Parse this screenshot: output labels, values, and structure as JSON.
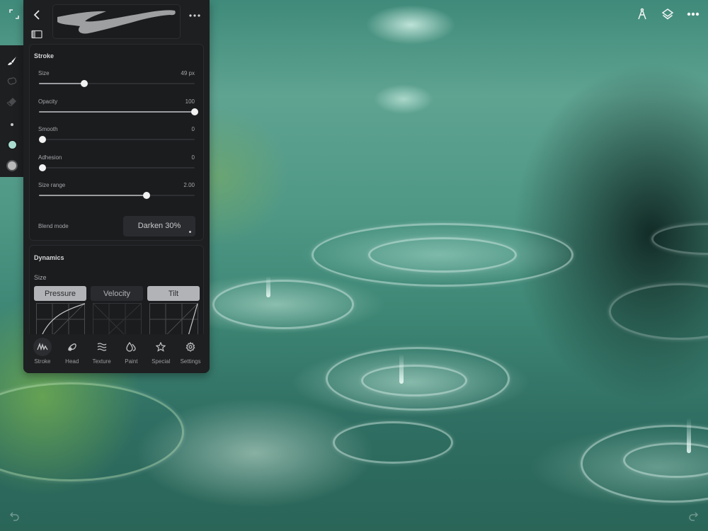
{
  "canvas": {
    "description": "painted rain ripples on water",
    "palette": {
      "teal": "#4f9886",
      "dark_teal": "#1c3b34",
      "green": "#6eaa50",
      "highlight": "#e6fff5"
    }
  },
  "top_toolbar": {
    "icons": [
      "ruler-compass-icon",
      "layers-icon",
      "more-icon"
    ]
  },
  "tool_rail": {
    "tools": [
      {
        "name": "brush",
        "icon": "brush-icon",
        "active": true
      },
      {
        "name": "smudge",
        "icon": "smudge-icon",
        "active": false
      },
      {
        "name": "eraser",
        "icon": "eraser-icon",
        "active": false
      },
      {
        "name": "size",
        "icon": "size-dot-icon",
        "active": false
      },
      {
        "name": "color",
        "icon": "color-swatch-icon",
        "value": "#a8ddd0"
      },
      {
        "name": "opacity",
        "icon": "opacity-swatch-icon",
        "value": "#b8b8b8"
      }
    ]
  },
  "panel": {
    "stroke": {
      "title": "Stroke",
      "sliders": [
        {
          "label": "Size",
          "value": "49 px",
          "fraction": 0.29
        },
        {
          "label": "Opacity",
          "value": "100",
          "fraction": 1.0
        },
        {
          "label": "Smooth",
          "value": "0",
          "fraction": 0.0
        },
        {
          "label": "Adhesion",
          "value": "0",
          "fraction": 0.0
        },
        {
          "label": "Size range",
          "value": "2.00",
          "fraction": 0.69
        }
      ],
      "blend_mode": {
        "label": "Blend mode",
        "value": "Darken 30%"
      }
    },
    "dynamics": {
      "title": "Dynamics",
      "subtitle": "Size",
      "tabs": [
        {
          "label": "Pressure",
          "active": true
        },
        {
          "label": "Velocity",
          "active": false
        },
        {
          "label": "Tilt",
          "active": true
        }
      ]
    },
    "bottom_tabs": [
      {
        "label": "Stroke",
        "icon": "stroke-icon",
        "active": true
      },
      {
        "label": "Head",
        "icon": "head-icon",
        "active": false
      },
      {
        "label": "Texture",
        "icon": "texture-icon",
        "active": false
      },
      {
        "label": "Paint",
        "icon": "paint-icon",
        "active": false
      },
      {
        "label": "Special",
        "icon": "star-icon",
        "active": false
      },
      {
        "label": "Settings",
        "icon": "gear-icon",
        "active": false
      }
    ]
  }
}
